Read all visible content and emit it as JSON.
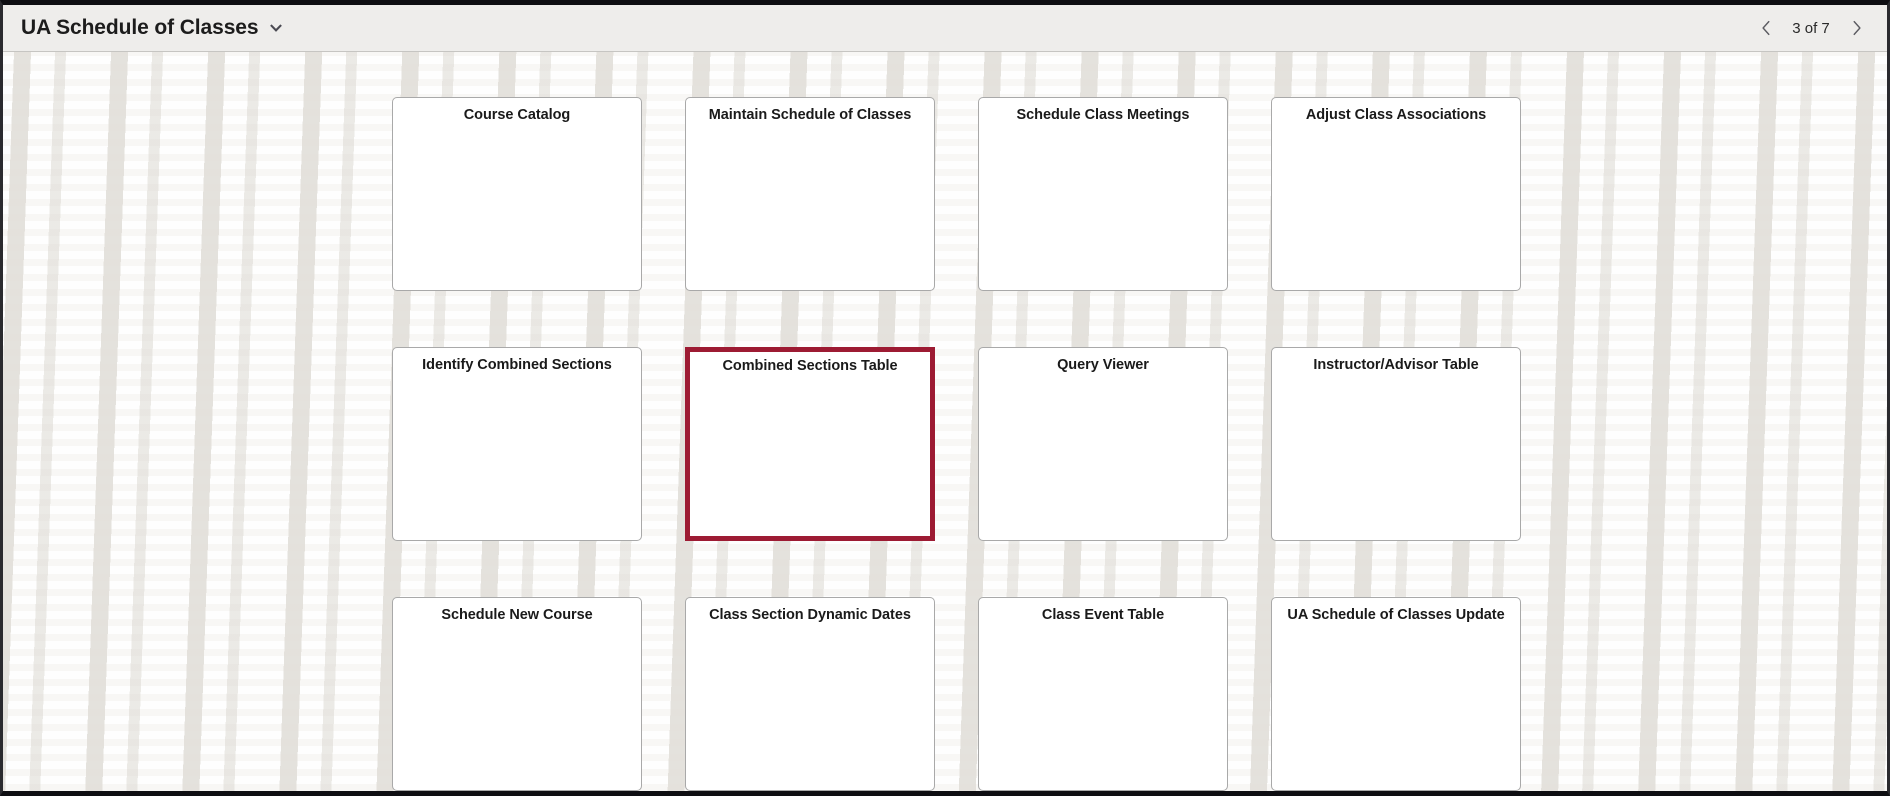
{
  "header": {
    "title": "UA Schedule of Classes",
    "title_chevron_icon": "chevron-down-icon",
    "pager": {
      "prev_icon": "chevron-left-icon",
      "next_icon": "chevron-right-icon",
      "count_label": "3 of 7",
      "current_page": 3,
      "total_pages": 7
    }
  },
  "colors": {
    "selected_tile_border": "#9d1b33",
    "header_background": "#eeedeb",
    "tile_border": "#a9a9a9",
    "board_background": "#f8f7f5"
  },
  "tiles": [
    {
      "label": "Course Catalog",
      "selected": false
    },
    {
      "label": "Maintain Schedule of Classes",
      "selected": false
    },
    {
      "label": "Schedule Class Meetings",
      "selected": false
    },
    {
      "label": "Adjust Class Associations",
      "selected": false
    },
    {
      "label": "Identify Combined Sections",
      "selected": false
    },
    {
      "label": "Combined Sections Table",
      "selected": true
    },
    {
      "label": "Query Viewer",
      "selected": false
    },
    {
      "label": "Instructor/Advisor Table",
      "selected": false
    },
    {
      "label": "Schedule New Course",
      "selected": false
    },
    {
      "label": "Class Section Dynamic Dates",
      "selected": false
    },
    {
      "label": "Class Event Table",
      "selected": false
    },
    {
      "label": "UA Schedule of Classes Update",
      "selected": false
    }
  ]
}
